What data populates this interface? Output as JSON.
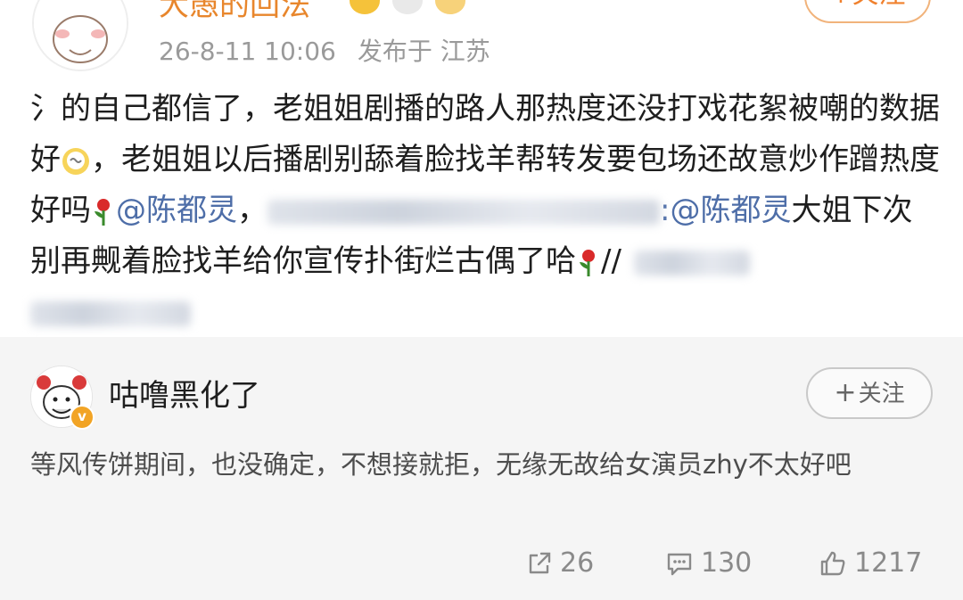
{
  "post": {
    "author": "大愚的回法",
    "follow_label": "+关注",
    "time": "26-8-11 10:06",
    "location": "发布于 江苏",
    "text": {
      "p1": "氵的自己都信了，老姐姐剧播的路人那热度还没打戏花絮被嘲的数据好",
      "p2": "，老姐姐以后播剧别舔着脸找羊帮转发要包场还故意炒作蹭热度好吗",
      "mention1": "@陈都灵",
      "sep1": "，",
      "mention2": ":@陈都灵",
      "p3": "大姐下次别再觍着脸找羊给你宣传扑街烂古偶了哈",
      "p4": "//"
    }
  },
  "repost": {
    "author": "咕噜黑化了",
    "verified_mark": "v",
    "follow_label": "关注",
    "follow_plus": "+",
    "text": "等风传饼期间，也没确定，不想接就拒，无缘无故给女演员zhy不太好吧",
    "actions": {
      "share_count": "26",
      "comment_count": "130",
      "like_count": "1217"
    }
  },
  "colors": {
    "mention": "#4e6ea8",
    "author_highlight": "#e8862c",
    "card_bg": "#f5f5f5"
  },
  "icons": [
    "share-icon",
    "comment-icon",
    "like-icon",
    "rose-icon",
    "dizzy-emoji-icon"
  ]
}
